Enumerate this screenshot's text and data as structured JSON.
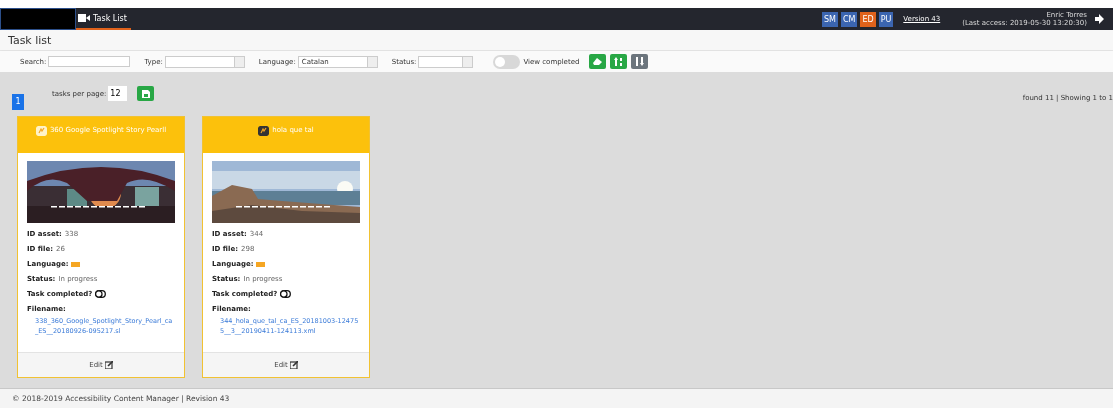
{
  "navbar": {
    "tabs": [
      {
        "label": "Task List",
        "selected": true
      }
    ],
    "roles": [
      {
        "label": "SM",
        "selected": false
      },
      {
        "label": "CM",
        "selected": false
      },
      {
        "label": "ED",
        "selected": true
      },
      {
        "label": "PU",
        "selected": false
      }
    ],
    "version": "Version 43",
    "user": "Enric Torres",
    "last_access": "(Last access: 2019-05-30 13:20:30)"
  },
  "page_title": "Task list",
  "filters": {
    "search_label": "Search:",
    "type_label": "Type:",
    "language_label": "Language:",
    "language_value": "Catalan",
    "status_label": "Status:",
    "view_completed": {
      "label": "View completed",
      "on": false
    }
  },
  "pagination": {
    "pages": [
      {
        "label": "1",
        "selected": true
      }
    ],
    "per_page_label": "tasks per page:",
    "per_page_value": "12",
    "summary": "found 11 | Showing 1 to 1"
  },
  "cards": [
    {
      "title": "360 Google Spotlight Story Pearll",
      "fields": [
        {
          "label": "ID asset:",
          "value": "338"
        },
        {
          "label": "ID file:",
          "value": "26"
        },
        {
          "label": "Status:",
          "value": "In progress"
        }
      ],
      "language_label": "Language:",
      "task_completed_label": "Task completed?",
      "completed": false,
      "filename_label": "Filename:",
      "filename": "338_360_Google_Spotlight_Story_Pearl_ca_ES__20180926-095217.sl",
      "edit": "Edit"
    },
    {
      "title": "hola que tal",
      "fields": [
        {
          "label": "ID asset:",
          "value": "344"
        },
        {
          "label": "ID file:",
          "value": "298"
        },
        {
          "label": "Status:",
          "value": "In progress"
        }
      ],
      "language_label": "Language:",
      "task_completed_label": "Task completed?",
      "completed": false,
      "filename_label": "Filename:",
      "filename": "344_hola_que_tal_ca_ES_20181003-124755__3__20190411-124113.xml",
      "edit": "Edit"
    }
  ],
  "footer": "© 2018-2019 Accessibility Content Manager | Revision 43"
}
